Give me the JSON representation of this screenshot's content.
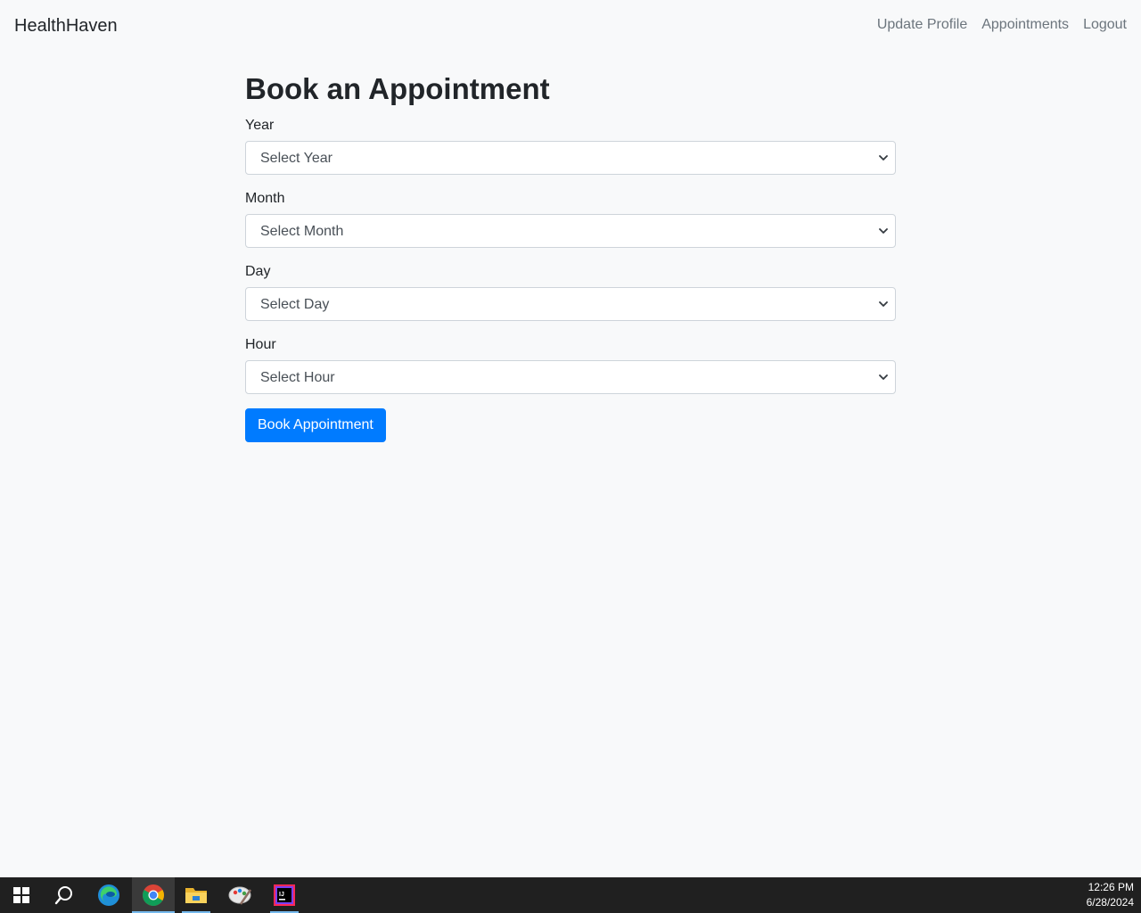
{
  "navbar": {
    "brand": "HealthHaven",
    "links": [
      "Update Profile",
      "Appointments",
      "Logout"
    ]
  },
  "page": {
    "title": "Book an Appointment"
  },
  "form": {
    "fields": [
      {
        "label": "Year",
        "placeholder": "Select Year"
      },
      {
        "label": "Month",
        "placeholder": "Select Month"
      },
      {
        "label": "Day",
        "placeholder": "Select Day"
      },
      {
        "label": "Hour",
        "placeholder": "Select Hour"
      }
    ],
    "submit_label": "Book Appointment"
  },
  "taskbar": {
    "apps": [
      "start-icon",
      "search-icon",
      "edge-icon",
      "chrome-icon",
      "file-explorer-icon",
      "paint-icon",
      "intellij-icon"
    ],
    "time": "12:26 PM",
    "date": "6/28/2024"
  },
  "colors": {
    "background": "#f8f9fa",
    "primary": "#007bff",
    "nav_link": "#6c757d",
    "taskbar": "#202020"
  }
}
